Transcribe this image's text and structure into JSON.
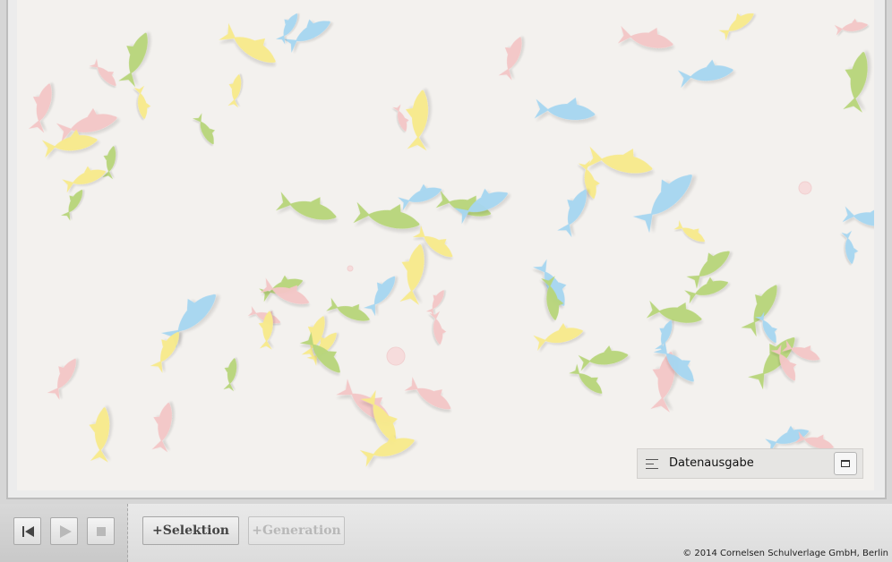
{
  "panel": {
    "title": "Datenausgabe"
  },
  "toolbar": {
    "selection_label": "+Selektion",
    "generation_label": "+Generation",
    "copyright": "© 2014 Cornelsen Schulverlage GmbH, Berlin"
  },
  "icons": {
    "rewind": "skip-to-start-icon",
    "play": "play-icon",
    "stop": "stop-icon",
    "menu": "menu-icon",
    "expand": "window-maximize-icon"
  },
  "colors": {
    "fish_green": "#b7d57a",
    "fish_yellow": "#f8ea8a",
    "fish_blue": "#a6d6f1",
    "fish_pink": "#f4c6c6",
    "canvas_bg": "#f3f1ee"
  }
}
